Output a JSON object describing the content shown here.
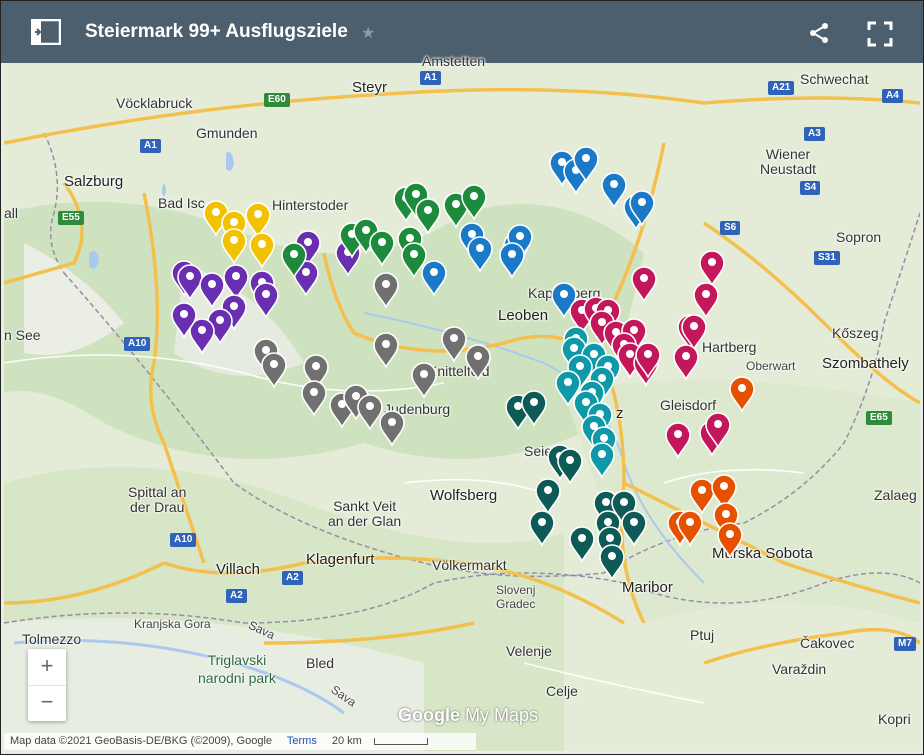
{
  "header": {
    "title": "Steiermark 99+ Ausflugsziele",
    "star_icon": "star-icon",
    "panel_icon": "side-panel-icon",
    "share_icon": "share-icon",
    "fullscreen_icon": "fullscreen-icon"
  },
  "map": {
    "places": [
      {
        "id": "amstetten",
        "label": "Amstetten"
      },
      {
        "id": "schwechat",
        "label": "Schwechat"
      },
      {
        "id": "steyr",
        "label": "Steyr"
      },
      {
        "id": "voecklabruck",
        "label": "Vöcklabruck"
      },
      {
        "id": "gmunden",
        "label": "Gmunden"
      },
      {
        "id": "wiener_neustadt",
        "label": "Wiener\nNeustadt"
      },
      {
        "id": "salzburg",
        "label": "Salzburg"
      },
      {
        "id": "bad_ischl",
        "label": "Bad Isc"
      },
      {
        "id": "hall",
        "label": "all"
      },
      {
        "id": "hinterstoder",
        "label": "Hinterstoder"
      },
      {
        "id": "sopron",
        "label": "Sopron"
      },
      {
        "id": "kapfenberg",
        "label": "Kapfenberg"
      },
      {
        "id": "leoben",
        "label": "Leoben"
      },
      {
        "id": "koszeg",
        "label": "Kőszeg"
      },
      {
        "id": "see",
        "label": "n See"
      },
      {
        "id": "hartberg",
        "label": "Hartberg"
      },
      {
        "id": "szombathely",
        "label": "Szombathely"
      },
      {
        "id": "oberwart",
        "label": "Oberwart"
      },
      {
        "id": "knittelfeld",
        "label": "Knittelfeld"
      },
      {
        "id": "judenburg",
        "label": "Judenburg"
      },
      {
        "id": "gleisdorf",
        "label": "Gleisdorf"
      },
      {
        "id": "graz",
        "label": "z"
      },
      {
        "id": "seiersberg",
        "label": "Seie"
      },
      {
        "id": "spittal",
        "label": "Spittal an\nder Drau"
      },
      {
        "id": "wolfsberg",
        "label": "Wolfsberg"
      },
      {
        "id": "zalaeg",
        "label": "Zalaeg"
      },
      {
        "id": "sankt_veit",
        "label": "Sankt Veit\nan der Glan"
      },
      {
        "id": "murska",
        "label": "Murska Sobota"
      },
      {
        "id": "villach",
        "label": "Villach"
      },
      {
        "id": "klagenfurt",
        "label": "Klagenfurt"
      },
      {
        "id": "voelkermarkt",
        "label": "Völkermarkt"
      },
      {
        "id": "maribor",
        "label": "Maribor"
      },
      {
        "id": "slovenj",
        "label": "Slovenj\nGradec"
      },
      {
        "id": "tolmezzo",
        "label": "Tolmezzo"
      },
      {
        "id": "kranjska",
        "label": "Kranjska Gora"
      },
      {
        "id": "sava1",
        "label": "Sava"
      },
      {
        "id": "ptuj",
        "label": "Ptuj"
      },
      {
        "id": "cakovec",
        "label": "Čakovec"
      },
      {
        "id": "triglav",
        "label": "Triglavski\nnarodni park"
      },
      {
        "id": "bled",
        "label": "Bled"
      },
      {
        "id": "velenje",
        "label": "Velenje"
      },
      {
        "id": "varazdin",
        "label": "Varaždin"
      },
      {
        "id": "sava2",
        "label": "Sava"
      },
      {
        "id": "celje",
        "label": "Celje"
      },
      {
        "id": "kopri",
        "label": "Kopri"
      },
      {
        "id": "z_graz",
        "label": "z"
      }
    ],
    "roads": [
      "A1",
      "A21",
      "E60",
      "A4",
      "A1",
      "A3",
      "S4",
      "E55",
      "S6",
      "S31",
      "A10",
      "E65",
      "A10",
      "A2",
      "A2",
      "M7"
    ],
    "marker_colors": {
      "yellow": "#f2c200",
      "purple": "#6a2fb0",
      "gray": "#707070",
      "green": "#1e8a3c",
      "blue": "#1a7ac8",
      "magenta": "#c2185b",
      "teal": "#0f99a8",
      "darkteal": "#0d5a56",
      "orange": "#e65100"
    },
    "zoom_in_label": "+",
    "zoom_out_label": "−",
    "logo_google": "Google",
    "logo_mymaps": "My Maps",
    "attribution": "Map data ©2021 GeoBasis-DE/BKG (©2009), Google",
    "terms": "Terms",
    "scale": "20 km"
  }
}
